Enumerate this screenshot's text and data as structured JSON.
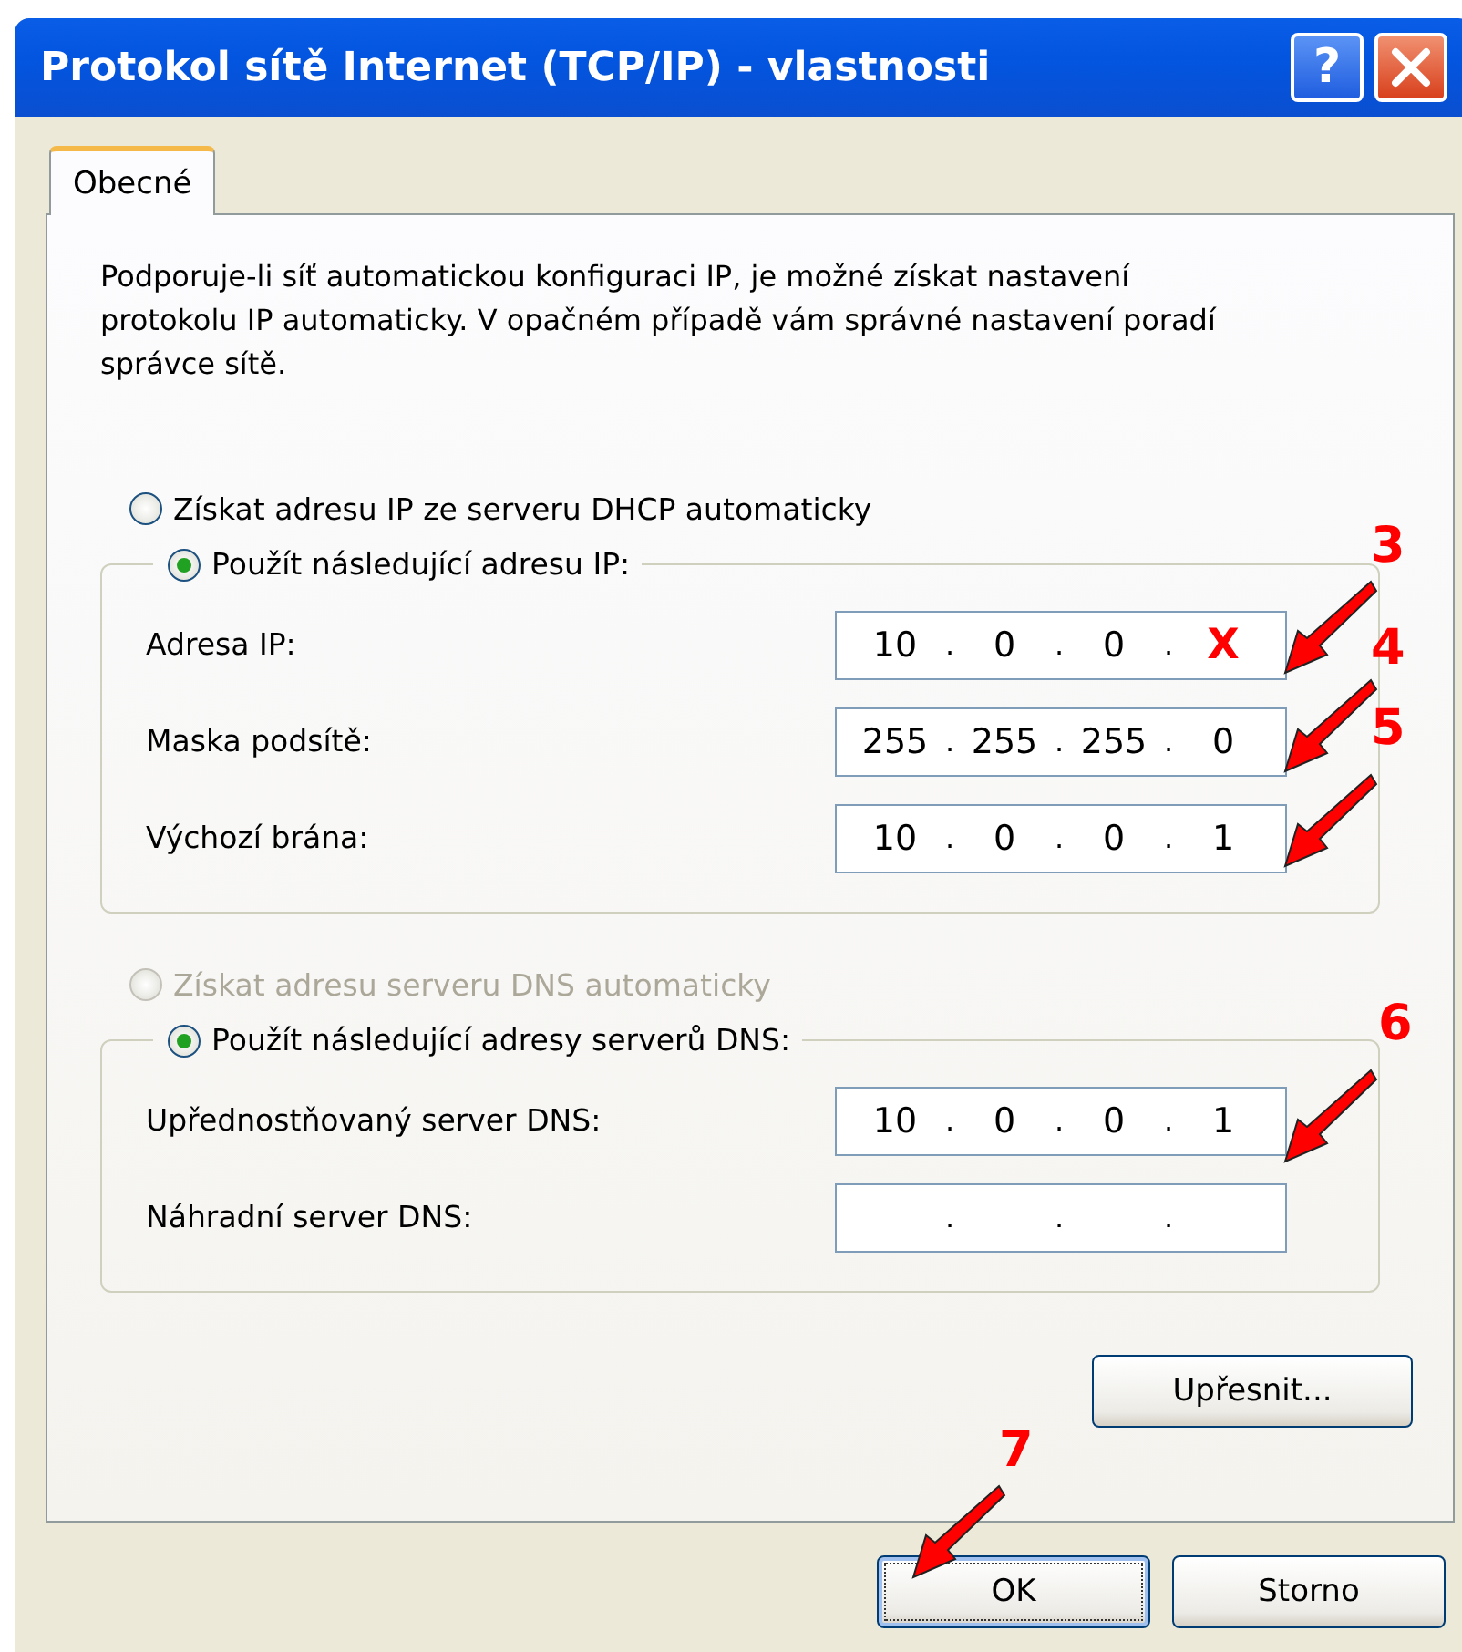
{
  "window": {
    "title": "Protokol sítě Internet (TCP/IP) - vlastnosti",
    "help_button": "?"
  },
  "tabs": [
    {
      "label": "Obecné",
      "selected": true
    }
  ],
  "description": "Podporuje-li síť automatickou konfiguraci IP, je možné získat nastavení protokolu IP automaticky. V opačném případě vám správné nastavení poradí správce sítě.",
  "ip": {
    "auto": {
      "label": "Získat adresu IP ze serveru DHCP automaticky",
      "selected": false,
      "disabled": false
    },
    "manual": {
      "label": "Použít následující adresu IP:",
      "selected": true,
      "disabled": false
    },
    "fields": [
      {
        "label": "Adresa IP:",
        "segments": [
          {
            "kind": "octet",
            "text": "10"
          },
          {
            "kind": "dot",
            "text": "."
          },
          {
            "kind": "octet",
            "text": "0"
          },
          {
            "kind": "dot",
            "text": "."
          },
          {
            "kind": "octet",
            "text": "0"
          },
          {
            "kind": "dot",
            "text": "."
          },
          {
            "kind": "mark",
            "text": "X"
          }
        ]
      },
      {
        "label": "Maska podsítě:",
        "segments": [
          {
            "kind": "octet",
            "text": "255"
          },
          {
            "kind": "dot",
            "text": "."
          },
          {
            "kind": "octet",
            "text": "255"
          },
          {
            "kind": "dot",
            "text": "."
          },
          {
            "kind": "octet",
            "text": "255"
          },
          {
            "kind": "dot",
            "text": "."
          },
          {
            "kind": "octet",
            "text": "0"
          }
        ]
      },
      {
        "label": "Výchozí brána:",
        "segments": [
          {
            "kind": "octet",
            "text": "10"
          },
          {
            "kind": "dot",
            "text": "."
          },
          {
            "kind": "octet",
            "text": "0"
          },
          {
            "kind": "dot",
            "text": "."
          },
          {
            "kind": "octet",
            "text": "0"
          },
          {
            "kind": "dot",
            "text": "."
          },
          {
            "kind": "octet",
            "text": "1"
          }
        ]
      }
    ]
  },
  "dns": {
    "auto": {
      "label": "Získat adresu serveru DNS automaticky",
      "selected": false,
      "disabled": true
    },
    "manual": {
      "label": "Použít následující adresy serverů DNS:",
      "selected": true,
      "disabled": false
    },
    "fields": [
      {
        "label": "Upřednostňovaný server DNS:",
        "segments": [
          {
            "kind": "octet",
            "text": "10"
          },
          {
            "kind": "dot",
            "text": "."
          },
          {
            "kind": "octet",
            "text": "0"
          },
          {
            "kind": "dot",
            "text": "."
          },
          {
            "kind": "octet",
            "text": "0"
          },
          {
            "kind": "dot",
            "text": "."
          },
          {
            "kind": "octet",
            "text": "1"
          }
        ]
      },
      {
        "label": "Náhradní server DNS:",
        "segments": [
          {
            "kind": "octet"
          },
          {
            "kind": "dot",
            "text": "."
          },
          {
            "kind": "octet"
          },
          {
            "kind": "dot",
            "text": "."
          },
          {
            "kind": "octet"
          },
          {
            "kind": "dot",
            "text": "."
          },
          {
            "kind": "octet"
          }
        ]
      }
    ]
  },
  "advanced_button": "Upřesnit...",
  "buttons": [
    {
      "label": "OK",
      "focused": true
    },
    {
      "label": "Storno",
      "focused": false
    }
  ],
  "annotations": [
    {
      "label": "3"
    },
    {
      "label": "4"
    },
    {
      "label": "5"
    },
    {
      "label": "6"
    },
    {
      "label": "7"
    }
  ]
}
